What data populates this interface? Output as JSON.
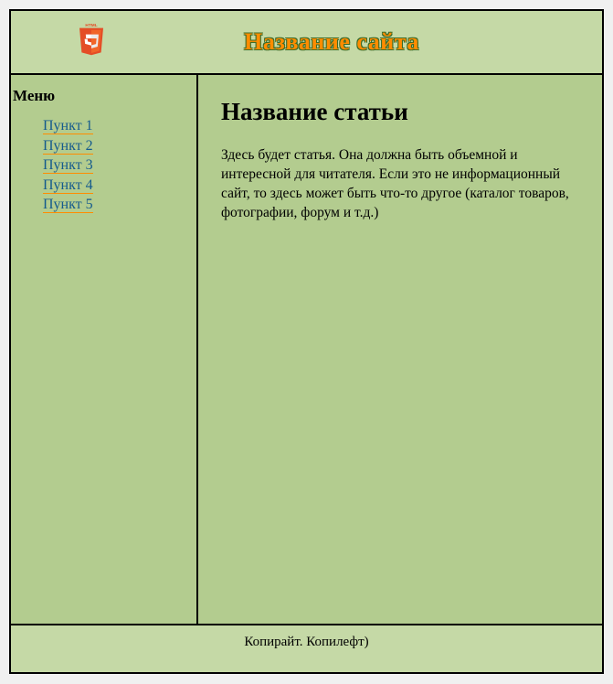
{
  "header": {
    "logo_name": "html5-icon",
    "site_title": "Название сайта"
  },
  "sidebar": {
    "title": "Меню",
    "items": [
      {
        "label": "Пункт 1"
      },
      {
        "label": "Пункт 2"
      },
      {
        "label": "Пункт 3"
      },
      {
        "label": "Пункт 4"
      },
      {
        "label": "Пункт 5"
      }
    ]
  },
  "article": {
    "title": "Название статьи",
    "body": "Здесь будет статья. Она должна быть объемной и интересной для читателя. Если это не информационный сайт, то здесь может быть что-то другое (каталог товаров, фотографии, форум и т.д.)"
  },
  "footer": {
    "text": "Копирайт. Копилефт)"
  }
}
